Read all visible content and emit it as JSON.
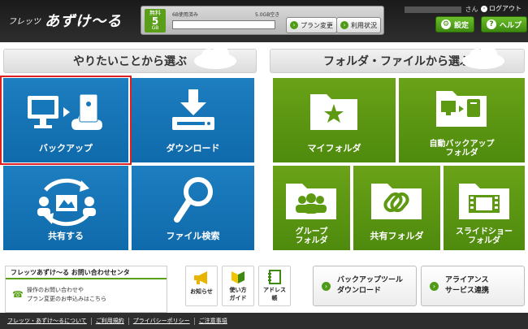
{
  "header": {
    "logo_small": "フレッツ",
    "logo_big": "あずけ〜る",
    "storage": {
      "badge_top": "無料",
      "badge_num": "5",
      "badge_unit": "GB",
      "used_label": "6B使用済み",
      "free_label": "5.0GB空き",
      "used_fraction": 0.0
    },
    "plan_change_label": "プラン変更",
    "usage_label": "利用状況",
    "user_suffix": "さん",
    "logout_label": "ログアウト",
    "settings_label": "設定",
    "help_label": "ヘルプ"
  },
  "left_section": {
    "title": "やりたいことから選ぶ"
  },
  "right_section": {
    "title": "フォルダ・ファイルから選ぶ"
  },
  "left_tiles": {
    "backup": "バックアップ",
    "download": "ダウンロード",
    "share": "共有する",
    "search": "ファイル検索"
  },
  "right_tiles": {
    "my_folder": "マイフォルダ",
    "auto_backup_1": "自動バックアップ",
    "auto_backup_2": "フォルダ",
    "group_1": "グループ",
    "group_2": "フォルダ",
    "shared_folder": "共有フォルダ",
    "slideshow_1": "スライドショー",
    "slideshow_2": "フォルダ"
  },
  "contact": {
    "title": "フレッツあずけ〜る お問い合わせセンタ",
    "line1": "操作のお問い合わせや",
    "line2": "プラン変更のお申込みはこちら"
  },
  "quick": {
    "news": "お知らせ",
    "guide_1": "使い方",
    "guide_2": "ガイド",
    "address_1": "アドレス",
    "address_2": "帳"
  },
  "wide_buttons": {
    "backup_tool_1": "バックアップツール",
    "backup_tool_2": "ダウンロード",
    "alliance_1": "アライアンス",
    "alliance_2": "サービス連携"
  },
  "footer": {
    "links": [
      "フレッツ・あずけ〜るについて",
      "ご利用規約",
      "プライバシーポリシー",
      "ご注意事項"
    ]
  },
  "colors": {
    "blue_tile": "#1678bb",
    "green_tile": "#5d9a12",
    "accent_green": "#4f9a17",
    "selection_red": "#e02020"
  }
}
